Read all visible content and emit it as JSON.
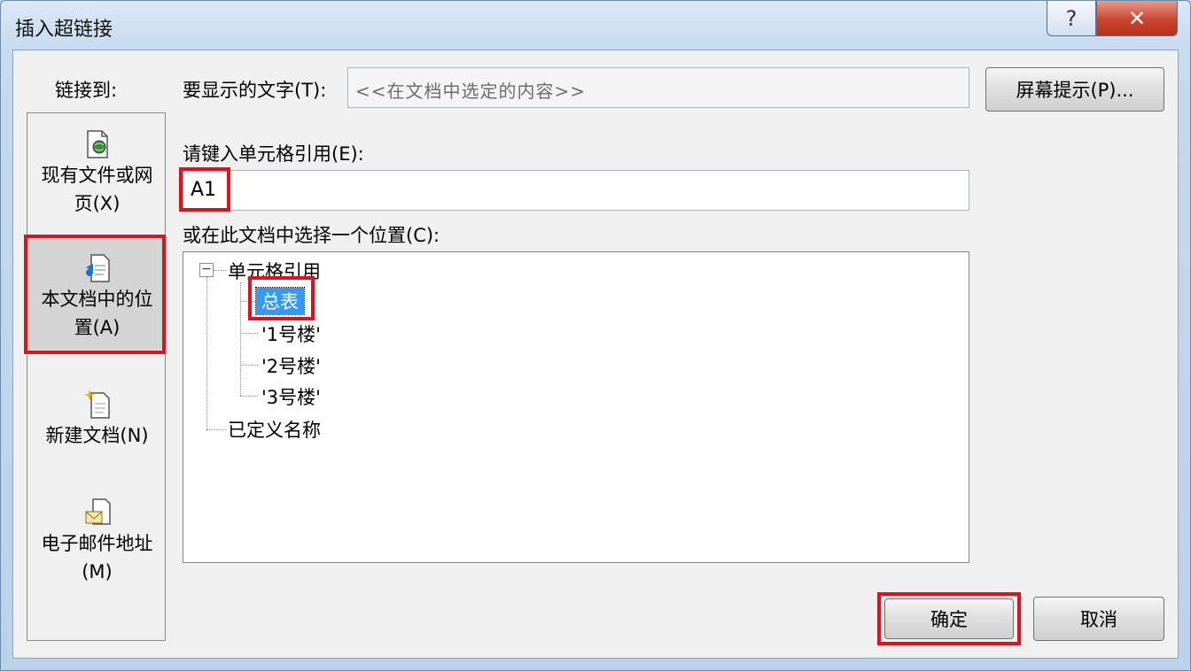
{
  "window": {
    "title": "插入超链接",
    "help_label": "?",
    "close_label": "✕"
  },
  "sidebar": {
    "label": "链接到:",
    "items": [
      {
        "line1": "现有文件或网",
        "line2": "页(X)",
        "icon": "file-web-icon"
      },
      {
        "line1": "本文档中的位",
        "line2": "置(A)",
        "icon": "document-place-icon",
        "selected": true
      },
      {
        "line1": "新建文档(N)",
        "line2": "",
        "icon": "new-document-icon"
      },
      {
        "line1": "电子邮件地址",
        "line2": "(M)",
        "icon": "email-icon"
      }
    ]
  },
  "display_text": {
    "label": "要显示的文字(T):",
    "value": "<<在文档中选定的内容>>"
  },
  "screen_tip_button": "屏幕提示(P)...",
  "cell_ref": {
    "label": "请键入单元格引用(E):",
    "value": "A1"
  },
  "place": {
    "label": "或在此文档中选择一个位置(C):",
    "expander": "−",
    "root": "单元格引用",
    "sheets": [
      "总表",
      "'1号楼'",
      "'2号楼'",
      "'3号楼'"
    ],
    "selected_index": 0,
    "defined_names": "已定义名称"
  },
  "buttons": {
    "ok": "确定",
    "cancel": "取消"
  },
  "colors": {
    "highlight_red": "#e0101c",
    "selection_blue": "#3399ff"
  }
}
